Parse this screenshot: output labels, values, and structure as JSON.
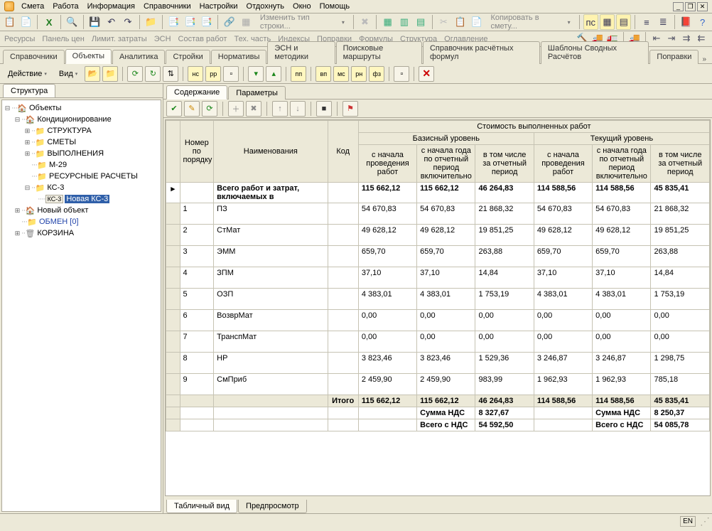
{
  "menu": [
    "Смета",
    "Работа",
    "Информация",
    "Справочники",
    "Настройки",
    "Отдохнуть",
    "Окно",
    "Помощь"
  ],
  "toolbar2": {
    "change_type": "Изменить тип строки...",
    "copy_to": "Копировать в смету..."
  },
  "texttabs": [
    "Ресурсы",
    "Панель цен",
    "Лимит. затраты",
    "ЭСН",
    "Состав работ",
    "Тех. часть",
    "Индексы",
    "Поправки",
    "Формулы",
    "Структура",
    "Оглавление"
  ],
  "navtabs": [
    "Справочники",
    "Объекты",
    "Аналитика",
    "Стройки",
    "Нормативы",
    "ЭСН и методики",
    "Поисковые маршруты",
    "Справочник расчётных формул",
    "Шаблоны Сводных Расчётов",
    "Поправки"
  ],
  "navtabs_active": 1,
  "actionbar": {
    "deystvie": "Действие",
    "vid": "Вид"
  },
  "left_tab": "Структура",
  "tree": {
    "root": "Объекты",
    "n1": "Кондиционирование",
    "n1a": "СТРУКТУРА",
    "n1b": "СМЕТЫ",
    "n1c": "ВЫПОЛНЕНИЯ",
    "n1d": "М-29",
    "n1e": "РЕСУРСНЫЕ РАСЧЕТЫ",
    "n1f": "КС-3",
    "n1f1_badge": "КС-3",
    "n1f1": "Новая КС-3",
    "n2": "Новый объект",
    "n3": "ОБМЕН  [0]",
    "n4": "КОРЗИНА"
  },
  "content_tabs": [
    "Содержание",
    "Параметры"
  ],
  "content_tabs_active": 0,
  "grid": {
    "super_header": "Стоимость выполненных работ",
    "group_headers": [
      "Базисный уровень",
      "Текущий уровень"
    ],
    "head_rownum": "Номер по порядку",
    "head_name": "Наименования",
    "head_code": "Код",
    "sub_headers": [
      "с начала проведения работ",
      "с начала года по отчетный период включительно",
      "в том числе за отчетный период"
    ],
    "first": {
      "name": "Всего работ и затрат, включаемых в",
      "v": [
        "115 662,12",
        "115 662,12",
        "46 264,83",
        "114 588,56",
        "114 588,56",
        "45 835,41"
      ]
    },
    "rows": [
      {
        "n": "1",
        "name": "ПЗ",
        "v": [
          "54 670,83",
          "54 670,83",
          "21 868,32",
          "54 670,83",
          "54 670,83",
          "21 868,32"
        ]
      },
      {
        "n": "2",
        "name": "СтМат",
        "v": [
          "49 628,12",
          "49 628,12",
          "19 851,25",
          "49 628,12",
          "49 628,12",
          "19 851,25"
        ]
      },
      {
        "n": "3",
        "name": "ЭММ",
        "v": [
          "659,70",
          "659,70",
          "263,88",
          "659,70",
          "659,70",
          "263,88"
        ]
      },
      {
        "n": "4",
        "name": "ЗПМ",
        "v": [
          "37,10",
          "37,10",
          "14,84",
          "37,10",
          "37,10",
          "14,84"
        ]
      },
      {
        "n": "5",
        "name": "ОЗП",
        "v": [
          "4 383,01",
          "4 383,01",
          "1 753,19",
          "4 383,01",
          "4 383,01",
          "1 753,19"
        ]
      },
      {
        "n": "6",
        "name": "ВозврМат",
        "v": [
          "0,00",
          "0,00",
          "0,00",
          "0,00",
          "0,00",
          "0,00"
        ]
      },
      {
        "n": "7",
        "name": "ТранспМат",
        "v": [
          "0,00",
          "0,00",
          "0,00",
          "0,00",
          "0,00",
          "0,00"
        ]
      },
      {
        "n": "8",
        "name": "НР",
        "v": [
          "3 823,46",
          "3 823,46",
          "1 529,36",
          "3 246,87",
          "3 246,87",
          "1 298,75"
        ]
      },
      {
        "n": "9",
        "name": "СмПриб",
        "v": [
          "2 459,90",
          "2 459,90",
          "983,99",
          "1 962,93",
          "1 962,93",
          "785,18"
        ]
      }
    ],
    "totals": {
      "label": "Итого",
      "v": [
        "115 662,12",
        "115 662,12",
        "46 264,83",
        "114 588,56",
        "114 588,56",
        "45 835,41"
      ]
    },
    "vat": {
      "label": "Сумма НДС",
      "v1": "8 327,67",
      "v2": "8 250,37"
    },
    "with_vat": {
      "label": "Всего с НДС",
      "v1": "54 592,50",
      "v2": "54 085,78"
    }
  },
  "bottom_tabs": [
    "Табличный вид",
    "Предпросмотр"
  ],
  "bottom_tabs_active": 0,
  "status_lang": "EN"
}
